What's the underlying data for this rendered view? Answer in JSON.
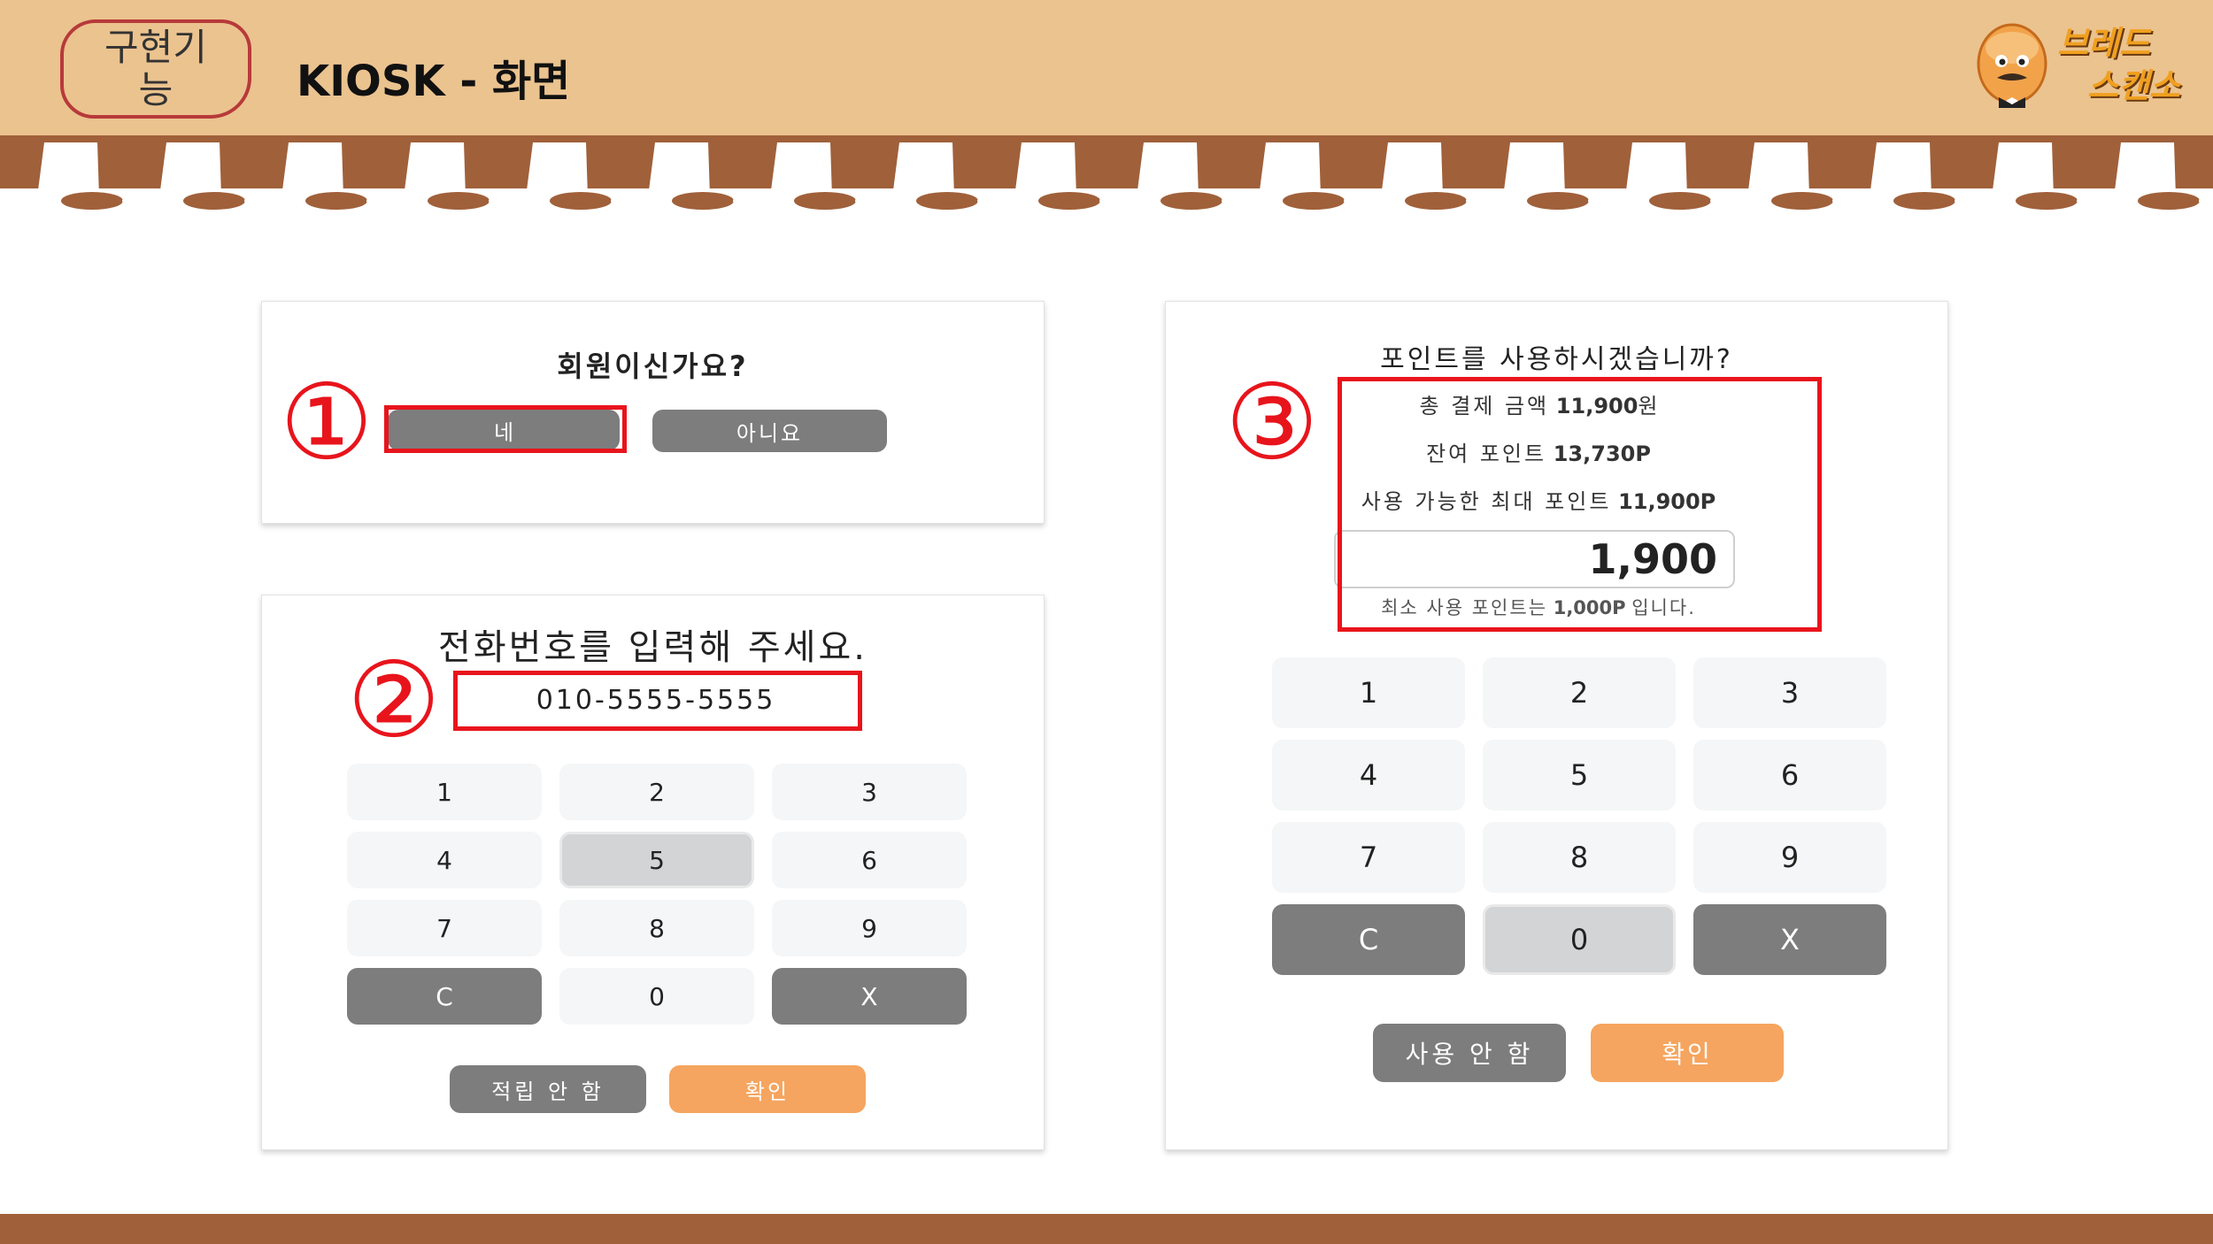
{
  "header": {
    "tag_label_line1": "구현기",
    "tag_label_line2": "능",
    "title": "KIOSK - 화면",
    "brand_line1": "브레드",
    "brand_line2": "스캔소"
  },
  "panel_member": {
    "question": "회원이신가요?",
    "yes_label": "네",
    "no_label": "아니요",
    "marker": "①"
  },
  "panel_phone": {
    "prompt": "전화번호를 입력해 주세요.",
    "phone_value": "010-5555-5555",
    "marker": "②",
    "keys": [
      "1",
      "2",
      "3",
      "4",
      "5",
      "6",
      "7",
      "8",
      "9",
      "C",
      "0",
      "X"
    ],
    "skip_label": "적립 안 함",
    "confirm_label": "확인"
  },
  "panel_points": {
    "question": "포인트를 사용하시겠습니까?",
    "marker": "③",
    "total_label": "총 결제 금액",
    "total_value": "11,900",
    "total_unit": "원",
    "balance_label": "잔여 포인트",
    "balance_value": "13,730P",
    "max_label": "사용 가능한 최대 포인트",
    "max_value": "11,900P",
    "input_value": "1,900",
    "min_notice_pre": "최소 사용 포인트는",
    "min_notice_value": "1,000P",
    "min_notice_post": "입니다.",
    "keys": [
      "1",
      "2",
      "3",
      "4",
      "5",
      "6",
      "7",
      "8",
      "9",
      "C",
      "0",
      "X"
    ],
    "skip_label": "사용 안 함",
    "confirm_label": "확인"
  },
  "colors": {
    "header_bg": "#ebc38f",
    "awning_brown": "#a0603a",
    "highlight_red": "#e8141c",
    "button_gray": "#7d7d7d",
    "button_orange": "#f5a55f"
  }
}
